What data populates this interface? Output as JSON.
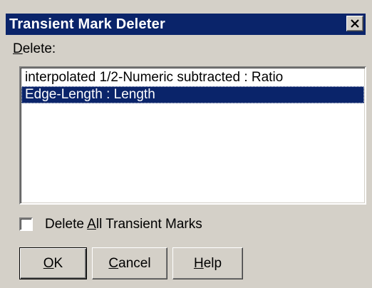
{
  "window": {
    "title": "Transient Mark Deleter"
  },
  "delete_label": {
    "mnemonic": "D",
    "rest": "elete:"
  },
  "list": {
    "items": [
      {
        "label": "interpolated 1/2-Numeric subtracted : Ratio",
        "selected": false
      },
      {
        "label": "Edge-Length : Length",
        "selected": true
      }
    ]
  },
  "checkbox": {
    "checked": false,
    "pre": "Delete ",
    "mnemonic": "A",
    "rest": "ll Transient Marks"
  },
  "buttons": {
    "ok": {
      "mnemonic": "O",
      "rest": "K"
    },
    "cancel": {
      "mnemonic": "C",
      "rest": "ancel"
    },
    "help": {
      "mnemonic": "H",
      "rest": "elp"
    }
  },
  "colors": {
    "titlebar": "#0a246a",
    "face": "#d4d0c8",
    "selection": "#0a246a"
  },
  "icons": {
    "close": "close-icon"
  }
}
